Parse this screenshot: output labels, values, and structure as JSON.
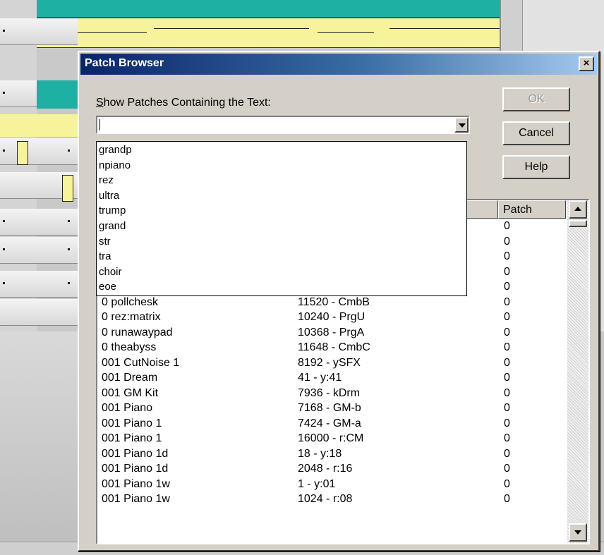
{
  "dialog": {
    "title": "Patch Browser",
    "close_label": "×",
    "search_label_mnemonic": "S",
    "search_label_rest": "how Patches Containing the Text:",
    "search_value": "",
    "buttons": {
      "ok": "OK",
      "cancel": "Cancel",
      "help": "Help"
    }
  },
  "dropdown_items": [
    "grandp",
    "npiano",
    "rez",
    "ultra",
    "trump",
    "grand",
    "str",
    "tra",
    "choir",
    "eoe"
  ],
  "list": {
    "header_patch": "Patch",
    "hidden_rows": [
      {
        "name": "",
        "bank": "",
        "patch": "0"
      },
      {
        "name": "",
        "bank": "",
        "patch": "0"
      },
      {
        "name": "",
        "bank": "",
        "patch": "0"
      },
      {
        "name": "",
        "bank": "",
        "patch": "0"
      },
      {
        "name": "",
        "bank": "",
        "patch": "0"
      }
    ],
    "partial_row": {
      "name": "0 pollchesk",
      "bank": "11520 - CmbB",
      "patch": "0"
    },
    "rows": [
      {
        "name": "0 rez:matrix",
        "bank": "10240 - PrgU",
        "patch": "0"
      },
      {
        "name": "0 runawaypad",
        "bank": "10368 - PrgA",
        "patch": "0"
      },
      {
        "name": "0 theabyss",
        "bank": "11648 - CmbC",
        "patch": "0"
      },
      {
        "name": "001 CutNoise 1",
        "bank": "8192 - ySFX",
        "patch": "0"
      },
      {
        "name": "001 Dream",
        "bank": "41 - y:41",
        "patch": "0"
      },
      {
        "name": "001 GM Kit",
        "bank": "7936 - kDrm",
        "patch": "0"
      },
      {
        "name": "001 Piano",
        "bank": "7168 - GM-b",
        "patch": "0"
      },
      {
        "name": "001 Piano 1",
        "bank": "7424 - GM-a",
        "patch": "0"
      },
      {
        "name": "001 Piano 1",
        "bank": "16000 - r:CM",
        "patch": "0"
      },
      {
        "name": "001 Piano 1d",
        "bank": "18 - y:18",
        "patch": "0"
      },
      {
        "name": "001 Piano 1d",
        "bank": "2048 - r:16",
        "patch": "0"
      },
      {
        "name": "001 Piano 1w",
        "bank": "1 - y:01",
        "patch": "0"
      },
      {
        "name": "001 Piano 1w",
        "bank": "1024 - r:08",
        "patch": "0"
      }
    ]
  }
}
